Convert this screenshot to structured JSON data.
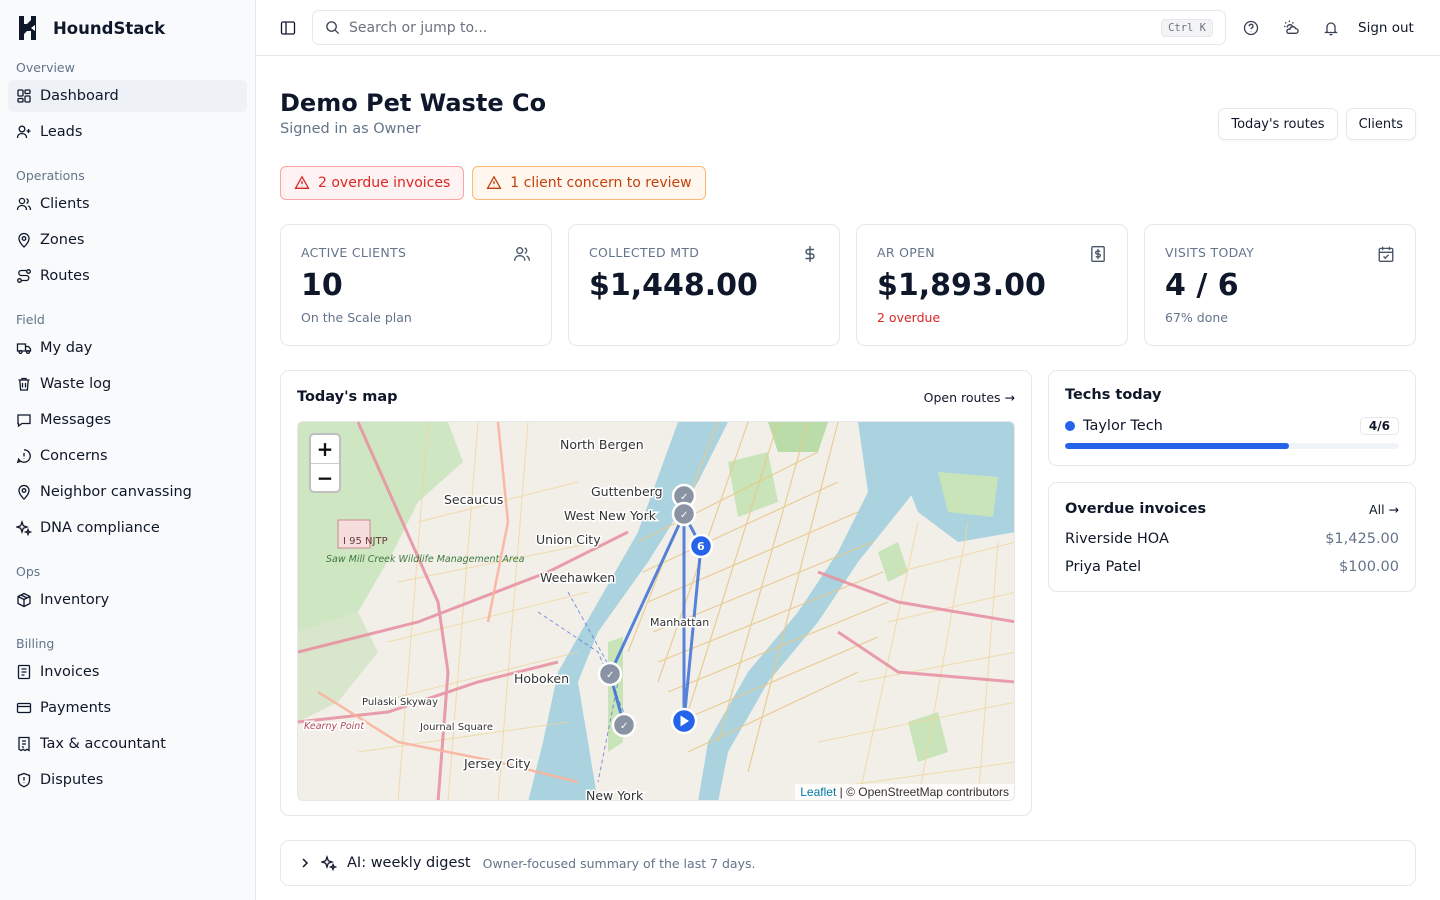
{
  "brand": {
    "name": "HoundStack"
  },
  "sidebar": {
    "groups": [
      {
        "label": "Overview",
        "items": [
          {
            "label": "Dashboard",
            "icon": "dashboard-icon"
          },
          {
            "label": "Leads",
            "icon": "user-plus-icon"
          }
        ]
      },
      {
        "label": "Operations",
        "items": [
          {
            "label": "Clients",
            "icon": "users-icon"
          },
          {
            "label": "Zones",
            "icon": "map-pin-icon"
          },
          {
            "label": "Routes",
            "icon": "route-icon"
          }
        ]
      },
      {
        "label": "Field",
        "items": [
          {
            "label": "My day",
            "icon": "truck-icon"
          },
          {
            "label": "Waste log",
            "icon": "trash-icon"
          },
          {
            "label": "Messages",
            "icon": "message-icon"
          },
          {
            "label": "Concerns",
            "icon": "alert-circle-icon"
          },
          {
            "label": "Neighbor canvassing",
            "icon": "map-pin-icon"
          },
          {
            "label": "DNA compliance",
            "icon": "sparkle-icon"
          }
        ]
      },
      {
        "label": "Ops",
        "items": [
          {
            "label": "Inventory",
            "icon": "package-icon"
          }
        ]
      },
      {
        "label": "Billing",
        "items": [
          {
            "label": "Invoices",
            "icon": "invoice-icon"
          },
          {
            "label": "Payments",
            "icon": "credit-card-icon"
          },
          {
            "label": "Tax & accountant",
            "icon": "receipt-icon"
          },
          {
            "label": "Disputes",
            "icon": "shield-alert-icon"
          }
        ]
      }
    ],
    "active": "Dashboard"
  },
  "topbar": {
    "search_placeholder": "Search or jump to...",
    "shortcut": "Ctrl K",
    "sign_out": "Sign out"
  },
  "page": {
    "title": "Demo Pet Waste Co",
    "subtitle": "Signed in as Owner",
    "buttons": {
      "routes": "Today's routes",
      "clients": "Clients"
    }
  },
  "alerts": {
    "overdue": "2 overdue invoices",
    "concern": "1 client concern to review"
  },
  "stats": [
    {
      "label": "ACTIVE CLIENTS",
      "value": "10",
      "sub": "On the Scale plan",
      "icon": "users-icon"
    },
    {
      "label": "COLLECTED MTD",
      "value": "$1,448.00",
      "sub": "",
      "icon": "dollar-icon"
    },
    {
      "label": "AR OPEN",
      "value": "$1,893.00",
      "sub": "2 overdue",
      "icon": "receipt-dollar-icon"
    },
    {
      "label": "VISITS TODAY",
      "value": "4 / 6",
      "sub": "67% done",
      "icon": "calendar-check-icon"
    }
  ],
  "map_card": {
    "title": "Today's map",
    "link": "Open routes →",
    "zoom_in": "+",
    "zoom_out": "−",
    "cluster_count": "6",
    "attribution_leaflet": "Leaflet",
    "attribution_osm": "| © OpenStreetMap contributors",
    "place_labels": [
      "North Bergen",
      "Secaucus",
      "Guttenberg",
      "West New York",
      "Union City",
      "Weehawken",
      "Manhattan",
      "Hoboken",
      "Jersey City",
      "New York",
      "Journal Square",
      "Pulaski Skyway",
      "Kearny Point",
      "I 95 NJTP",
      "Saw Mill Creek Wildlife Management Area"
    ]
  },
  "techs": {
    "title": "Techs today",
    "items": [
      {
        "name": "Taylor Tech",
        "count": "4/6",
        "progress": 0.67,
        "color": "#2563eb"
      }
    ]
  },
  "overdue": {
    "title": "Overdue invoices",
    "link": "All →",
    "items": [
      {
        "name": "Riverside HOA",
        "amount": "$1,425.00"
      },
      {
        "name": "Priya Patel",
        "amount": "$100.00"
      }
    ]
  },
  "digest": {
    "title": "AI: weekly digest",
    "subtitle": "Owner-focused summary of the last 7 days."
  },
  "colors": {
    "accent": "#2563eb",
    "danger": "#dc2626",
    "warning": "#c2410c"
  }
}
